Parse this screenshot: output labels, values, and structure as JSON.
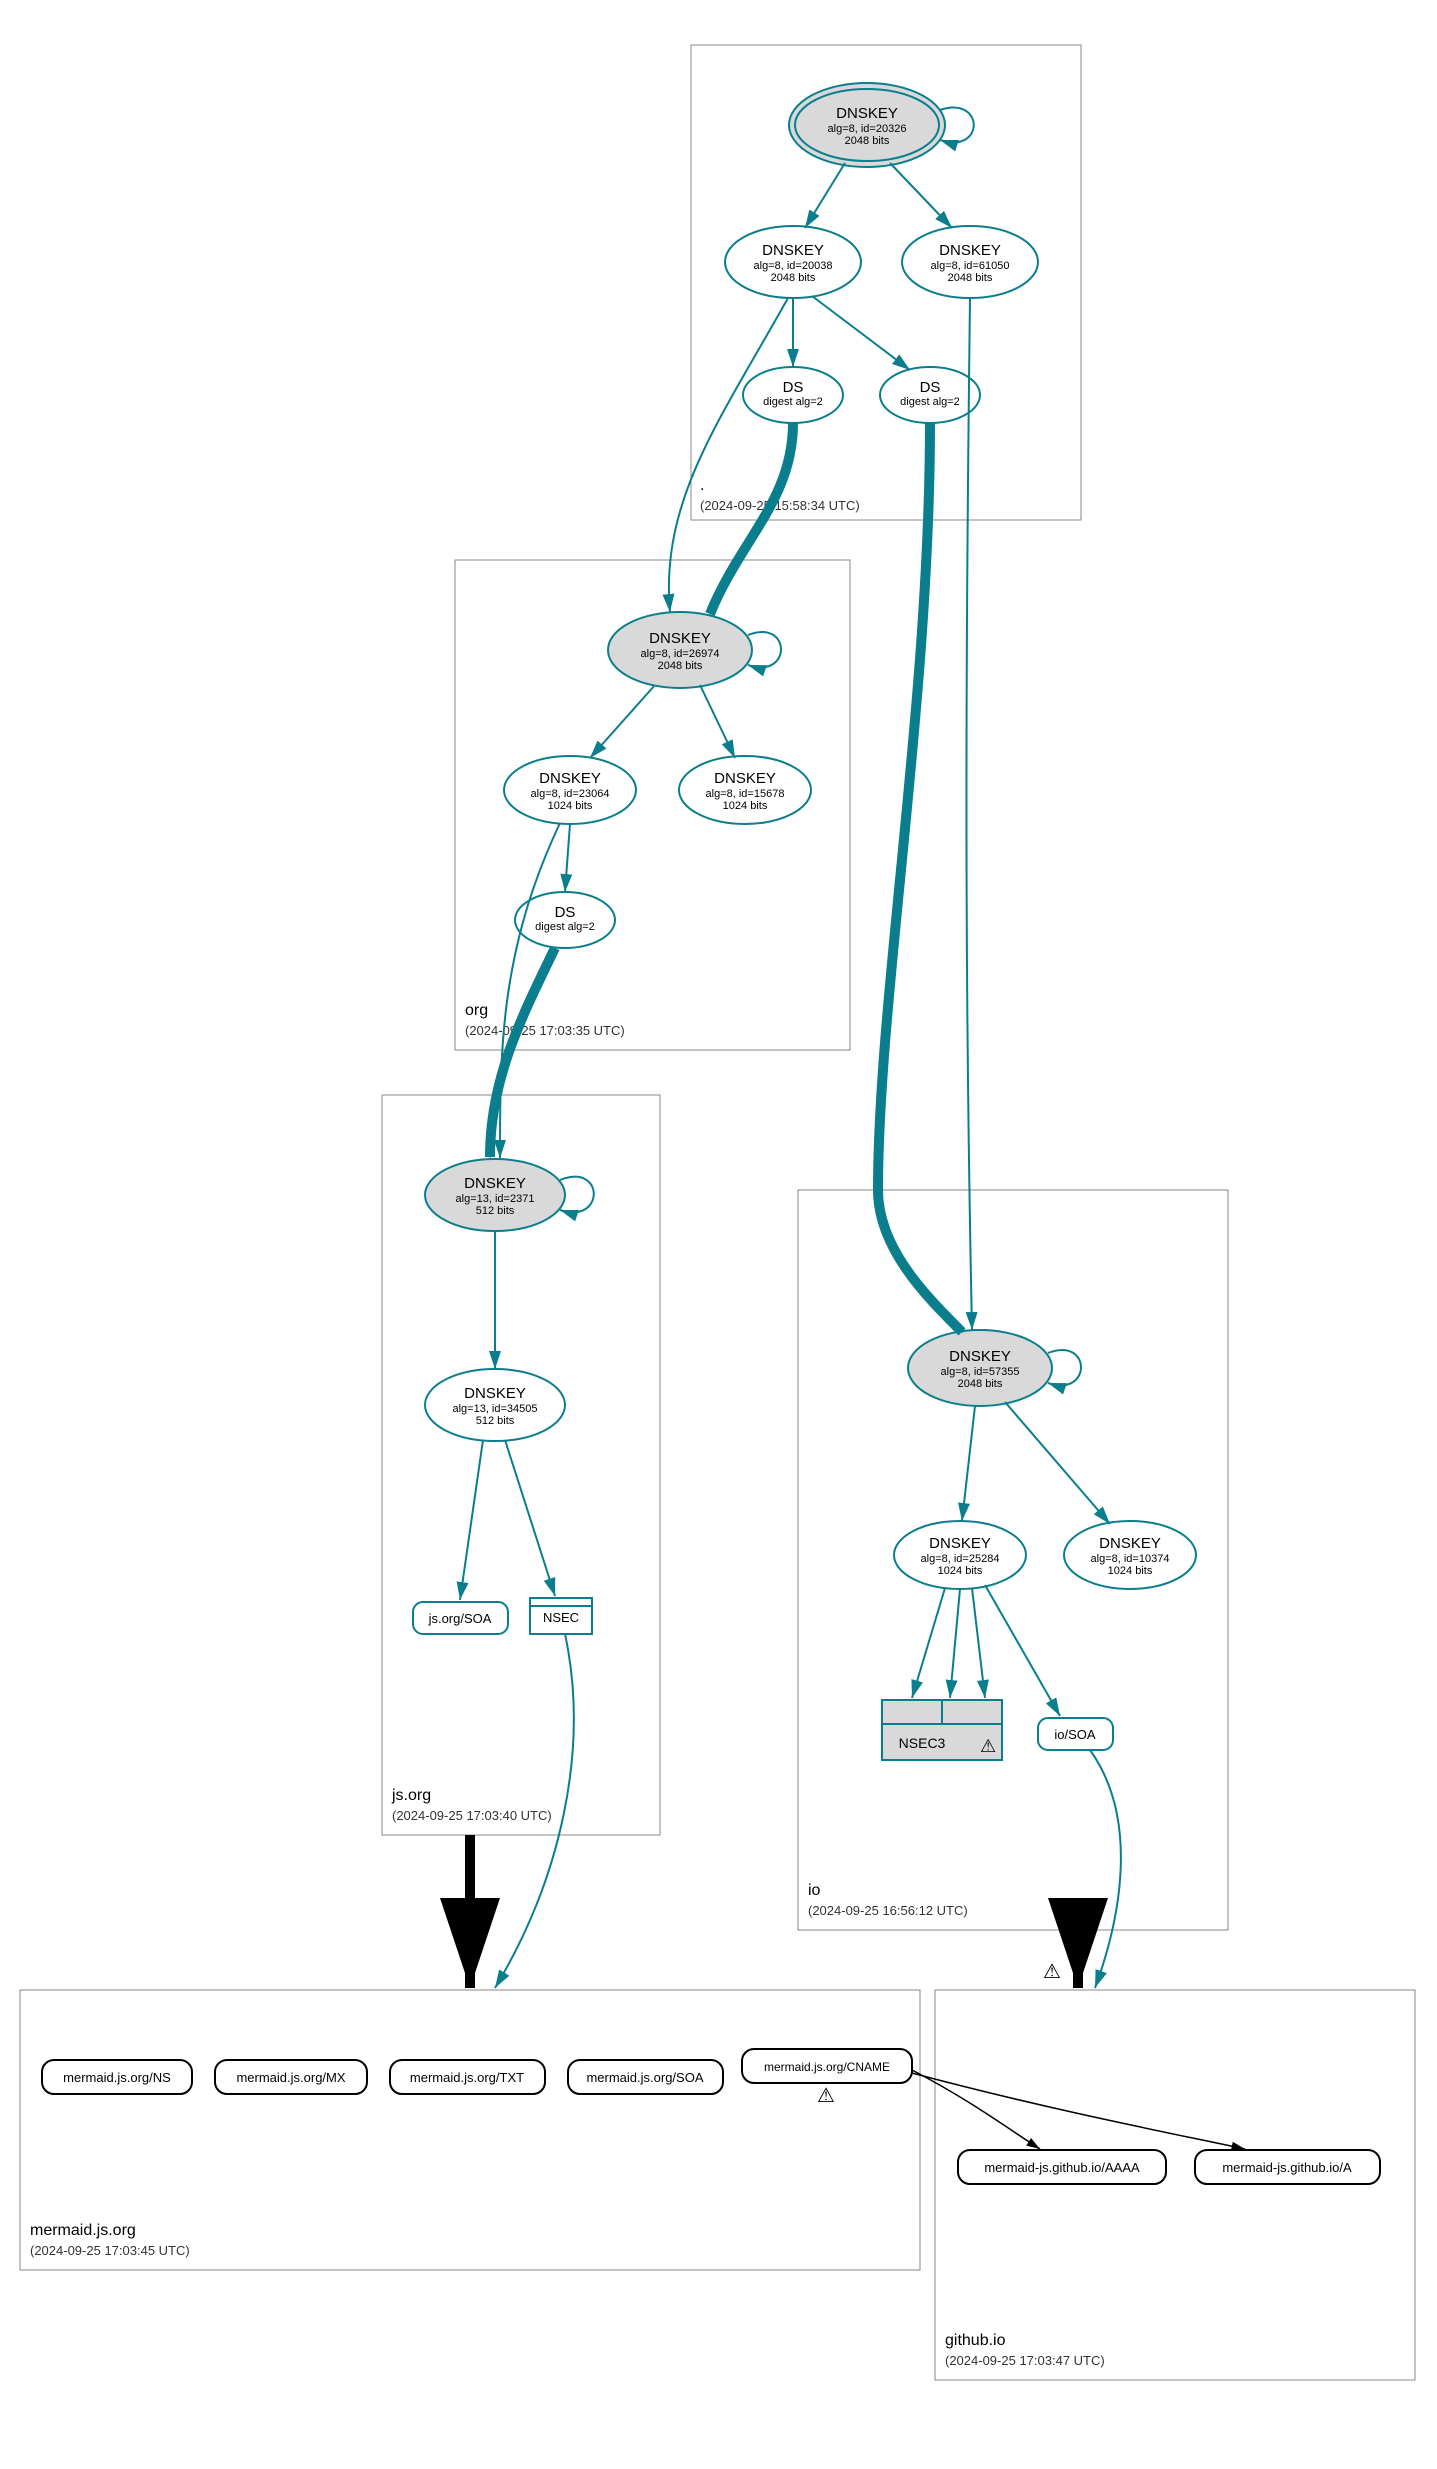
{
  "zones": {
    "root": {
      "name": ".",
      "time": "(2024-09-25 15:58:34 UTC)"
    },
    "org": {
      "name": "org",
      "time": "(2024-09-25 17:03:35 UTC)"
    },
    "jsorg": {
      "name": "js.org",
      "time": "(2024-09-25 17:03:40 UTC)"
    },
    "mermaidjsorg": {
      "name": "mermaid.js.org",
      "time": "(2024-09-25 17:03:45 UTC)"
    },
    "io": {
      "name": "io",
      "time": "(2024-09-25 16:56:12 UTC)"
    },
    "githubio": {
      "name": "github.io",
      "time": "(2024-09-25 17:03:47 UTC)"
    }
  },
  "nodes": {
    "root_ksk": {
      "title": "DNSKEY",
      "sub1": "alg=8, id=20326",
      "sub2": "2048 bits"
    },
    "root_zsk1": {
      "title": "DNSKEY",
      "sub1": "alg=8, id=20038",
      "sub2": "2048 bits"
    },
    "root_zsk2": {
      "title": "DNSKEY",
      "sub1": "alg=8, id=61050",
      "sub2": "2048 bits"
    },
    "root_ds1": {
      "title": "DS",
      "sub1": "digest alg=2"
    },
    "root_ds2": {
      "title": "DS",
      "sub1": "digest alg=2"
    },
    "org_ksk": {
      "title": "DNSKEY",
      "sub1": "alg=8, id=26974",
      "sub2": "2048 bits"
    },
    "org_zsk1": {
      "title": "DNSKEY",
      "sub1": "alg=8, id=23064",
      "sub2": "1024 bits"
    },
    "org_zsk2": {
      "title": "DNSKEY",
      "sub1": "alg=8, id=15678",
      "sub2": "1024 bits"
    },
    "org_ds": {
      "title": "DS",
      "sub1": "digest alg=2"
    },
    "jsorg_ksk": {
      "title": "DNSKEY",
      "sub1": "alg=13, id=2371",
      "sub2": "512 bits"
    },
    "jsorg_zsk": {
      "title": "DNSKEY",
      "sub1": "alg=13, id=34505",
      "sub2": "512 bits"
    },
    "jsorg_soa": {
      "title": "js.org/SOA"
    },
    "jsorg_nsec": {
      "title": "NSEC"
    },
    "io_ksk": {
      "title": "DNSKEY",
      "sub1": "alg=8, id=57355",
      "sub2": "2048 bits"
    },
    "io_zsk1": {
      "title": "DNSKEY",
      "sub1": "alg=8, id=25284",
      "sub2": "1024 bits"
    },
    "io_zsk2": {
      "title": "DNSKEY",
      "sub1": "alg=8, id=10374",
      "sub2": "1024 bits"
    },
    "io_nsec3": {
      "title": "NSEC3"
    },
    "io_soa": {
      "title": "io/SOA"
    },
    "m_ns": {
      "title": "mermaid.js.org/NS"
    },
    "m_mx": {
      "title": "mermaid.js.org/MX"
    },
    "m_txt": {
      "title": "mermaid.js.org/TXT"
    },
    "m_soa": {
      "title": "mermaid.js.org/SOA"
    },
    "m_cname": {
      "title": "mermaid.js.org/CNAME"
    },
    "gh_aaaa": {
      "title": "mermaid-js.github.io/AAAA"
    },
    "gh_a": {
      "title": "mermaid-js.github.io/A"
    }
  },
  "icons": {
    "warning": "⚠"
  }
}
